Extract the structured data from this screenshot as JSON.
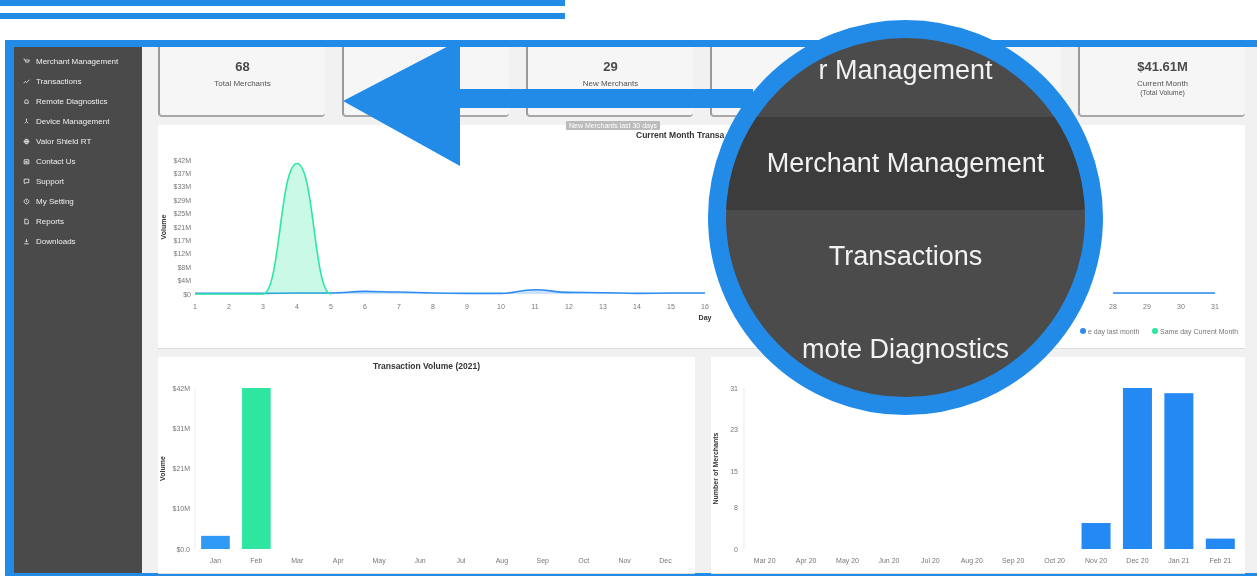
{
  "sidebar": {
    "items": [
      "Merchant Management",
      "Transactions",
      "Remote Diagnostics",
      "Device Management",
      "Valor Shield RT",
      "Contact Us",
      "Support",
      "My Setting",
      "Reports",
      "Downloads"
    ]
  },
  "cards": [
    {
      "value": "68",
      "label": "Total Merchants"
    },
    {
      "value": "29",
      "label": "New Merchants"
    },
    {
      "value": "$41.61M",
      "label": "Current Month",
      "sublabel": "(Total Volume)"
    }
  ],
  "tooltip": {
    "text": "New Merchants last 30 days"
  },
  "volume_panel": {
    "chart_data": {
      "type": "area",
      "title": "Current Month Transa",
      "xlabel": "Day",
      "ylabel": "Volume",
      "legend": "bottom-right",
      "x": [
        1,
        2,
        3,
        4,
        5,
        6,
        7,
        8,
        9,
        10,
        11,
        12,
        13,
        14,
        15,
        16,
        17,
        18,
        19,
        20,
        21,
        22,
        23,
        24,
        25,
        26,
        27,
        28,
        29,
        30,
        31
      ],
      "xticks": [
        1,
        2,
        3,
        4,
        5,
        6,
        7,
        8,
        9,
        10,
        11,
        12,
        13,
        14,
        15,
        16,
        28,
        29,
        30,
        31
      ],
      "xlim": [
        1,
        31
      ],
      "ylim": [
        0,
        41.6
      ],
      "yticks": [
        {
          "value": 0,
          "label": "$0"
        },
        {
          "value": 4.16,
          "label": "$4M"
        },
        {
          "value": 8.32,
          "label": "$8M"
        },
        {
          "value": 12.48,
          "label": "$12M"
        },
        {
          "value": 16.64,
          "label": "$17M"
        },
        {
          "value": 20.8,
          "label": "$21M"
        },
        {
          "value": 24.96,
          "label": "$25M"
        },
        {
          "value": 29.12,
          "label": "$29M"
        },
        {
          "value": 33.28,
          "label": "$33M"
        },
        {
          "value": 37.44,
          "label": "$37M"
        },
        {
          "value": 41.6,
          "label": "$42M"
        }
      ],
      "series": [
        {
          "name": "e day last month",
          "color": "#2e8cf0",
          "values": [
            0.2,
            0.2,
            0.2,
            0.3,
            0.3,
            0.8,
            0.6,
            0.3,
            0.2,
            0.2,
            1.3,
            0.5,
            0.4,
            0.2,
            0.3,
            0.3,
            null,
            null,
            null,
            null,
            null,
            null,
            null,
            null,
            null,
            null,
            null,
            0.3,
            0.3,
            0.3,
            0.3
          ]
        },
        {
          "name": "Same day Current Month",
          "color": "#2ee6a0",
          "values": [
            0,
            0,
            0,
            40.5,
            0,
            null,
            null,
            null,
            null,
            null,
            null,
            null,
            null,
            null,
            null,
            null,
            null,
            null,
            null,
            null,
            null,
            null,
            null,
            null,
            null,
            null,
            null,
            null,
            null,
            null,
            null
          ]
        }
      ]
    }
  },
  "yearly_panel": {
    "chart_data": {
      "type": "bar",
      "title": "Transaction Volume (2021)",
      "ylabel": "Volume",
      "categories": [
        "Jan",
        "Feb",
        "Mar",
        "Apr",
        "May",
        "Jun",
        "Jul",
        "Aug",
        "Sep",
        "Oct",
        "Nov",
        "Dec"
      ],
      "ylim": [
        0,
        41.6
      ],
      "yticks": [
        {
          "value": 0,
          "label": "$0.0"
        },
        {
          "value": 10.4,
          "label": "$10M"
        },
        {
          "value": 20.8,
          "label": "$21M"
        },
        {
          "value": 31.2,
          "label": "$31M"
        },
        {
          "value": 41.6,
          "label": "$42M"
        }
      ],
      "series": [
        {
          "color": "#2e9af5",
          "values": [
            3.4,
            null,
            null,
            null,
            null,
            null,
            null,
            null,
            null,
            null,
            null,
            null
          ]
        },
        {
          "color": "#2ee6a0",
          "values": [
            null,
            41.6,
            null,
            null,
            null,
            null,
            null,
            null,
            null,
            null,
            null,
            null
          ]
        }
      ]
    }
  },
  "merchants_panel": {
    "chart_data": {
      "type": "bar",
      "ylabel": "Number of Merchants",
      "categories": [
        "Mar 20",
        "Apr 20",
        "May 20",
        "Jun 20",
        "Jul 20",
        "Aug 20",
        "Sep 20",
        "Oct 20",
        "Nov 20",
        "Dec 20",
        "Jan 21",
        "Feb 21"
      ],
      "ylim": [
        0,
        31
      ],
      "yticks": [
        0,
        8,
        15,
        23,
        31
      ],
      "series": [
        {
          "color": "#2489f2",
          "values": [
            0,
            0,
            0,
            0,
            0,
            0,
            0,
            0,
            5,
            31,
            30,
            2
          ]
        }
      ]
    }
  },
  "magnifier": {
    "items": [
      {
        "label": "r Management",
        "selected": false
      },
      {
        "label": "Merchant Management",
        "selected": true
      },
      {
        "label": "Transactions",
        "selected": false
      },
      {
        "label": "mote Diagnostics",
        "selected": false
      }
    ]
  }
}
